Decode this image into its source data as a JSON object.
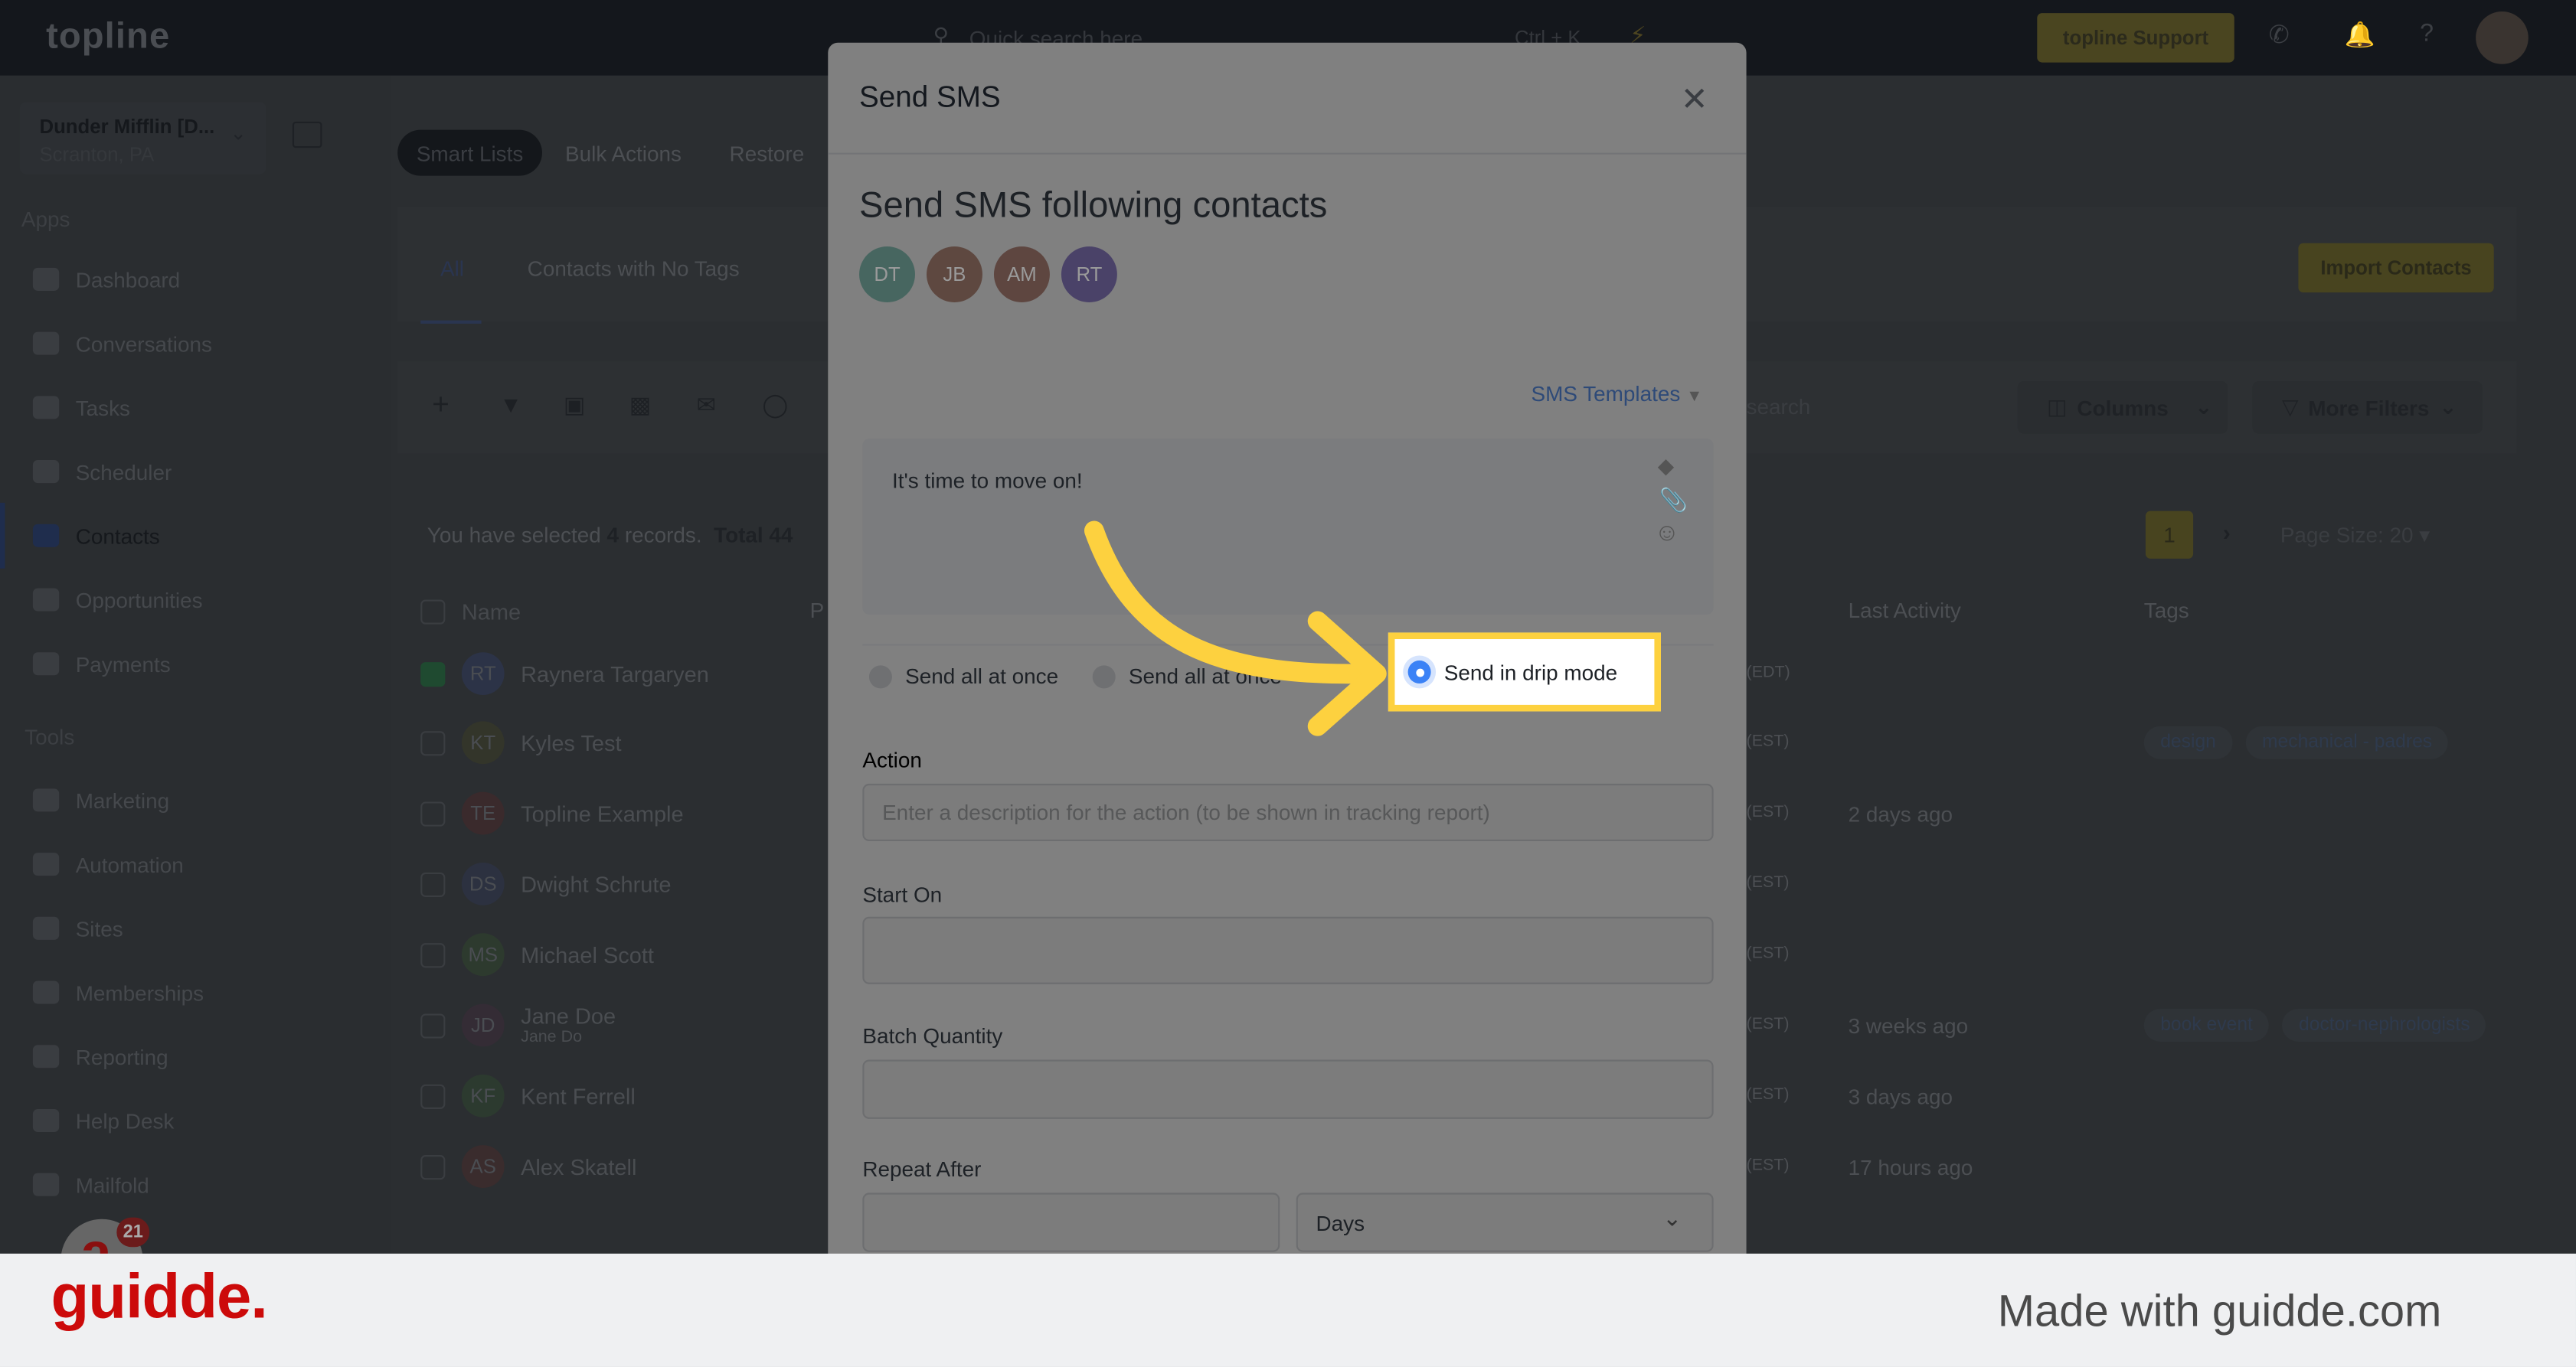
{
  "topbar": {
    "logo": "topline",
    "search_placeholder": "Quick search here",
    "search_shortcut": "Ctrl + K",
    "support_label": "topline Support",
    "icons": [
      "search-icon",
      "bolt-icon",
      "phone-icon",
      "bell-icon",
      "help-icon",
      "avatar"
    ]
  },
  "sidebar": {
    "account_name": "Dunder Mifflin [D...",
    "account_location": "Scranton, PA",
    "apps_label": "Apps",
    "apps": [
      {
        "label": "Dashboard"
      },
      {
        "label": "Conversations"
      },
      {
        "label": "Tasks"
      },
      {
        "label": "Scheduler"
      },
      {
        "label": "Contacts",
        "active": true
      },
      {
        "label": "Opportunities"
      },
      {
        "label": "Payments"
      }
    ],
    "tools_label": "Tools",
    "tools": [
      {
        "label": "Marketing"
      },
      {
        "label": "Automation"
      },
      {
        "label": "Sites"
      },
      {
        "label": "Memberships"
      },
      {
        "label": "Reporting"
      },
      {
        "label": "Help Desk"
      },
      {
        "label": "Mailfold"
      }
    ],
    "chat_badge": "21"
  },
  "contacts": {
    "top_tabs": [
      "Smart Lists",
      "Bulk Actions",
      "Restore"
    ],
    "list_tabs": [
      "All",
      "Contacts with No Tags"
    ],
    "import_label": "Import Contacts",
    "search_placeholder": "search",
    "columns_label": "Columns",
    "more_filters_label": "More Filters",
    "selected_prefix": "You have selected",
    "selected_count": "4",
    "selected_suffix": "records.",
    "total": "Total 44",
    "page": "1",
    "page_size": "Page Size: 20",
    "headers": {
      "name": "Name",
      "phone": "P",
      "last_activity": "Last Activity",
      "tags": "Tags"
    },
    "rows": [
      {
        "initials": "RT",
        "name": "Raynera Targaryen",
        "tz": "(EDT)",
        "activity": "",
        "tags": [],
        "checked": true,
        "color": "#2c3347"
      },
      {
        "initials": "KT",
        "name": "Kyles Test",
        "tz": "(EST)",
        "activity": "",
        "tags": [
          "design",
          "mechanical - padres"
        ],
        "color": "#33352a"
      },
      {
        "initials": "TE",
        "name": "Topline Example",
        "tz": "(EST)",
        "activity": "2 days ago",
        "tags": [],
        "color": "#3a2a2c"
      },
      {
        "initials": "DS",
        "name": "Dwight Schrute",
        "tz": "(EST)",
        "activity": "",
        "tags": [],
        "color": "#2c3140"
      },
      {
        "initials": "MS",
        "name": "Michael Scott",
        "tz": "(EST)",
        "activity": "",
        "tags": [],
        "color": "#2d3a2e"
      },
      {
        "initials": "JD",
        "name": "Jane Doe",
        "sub": "Jane Do",
        "tz": "(EST)",
        "activity": "3 weeks ago",
        "tags": [
          "book event",
          "doctor-nephrologists"
        ],
        "color": "#342c35"
      },
      {
        "initials": "KF",
        "name": "Kent Ferrell",
        "tz": "(EST)",
        "activity": "3 days ago",
        "tags": [],
        "color": "#2c3a2f"
      },
      {
        "initials": "AS",
        "name": "Alex Skatell",
        "tz": "(EST)",
        "activity": "17 hours ago",
        "tags": [],
        "color": "#3a2c2d"
      }
    ]
  },
  "modal": {
    "title": "Send SMS",
    "heading": "Send SMS following contacts",
    "recipients": [
      {
        "initials": "DT",
        "color": "#476660"
      },
      {
        "initials": "JB",
        "color": "#5e4840"
      },
      {
        "initials": "AM",
        "color": "#5e4640"
      },
      {
        "initials": "RT",
        "color": "#4a4268"
      }
    ],
    "templates_label": "SMS Templates",
    "message": "It's time to move on!",
    "send_options": [
      {
        "label": "Send all at once",
        "selected": false
      },
      {
        "label": "Send all at once",
        "selected": false
      },
      {
        "label": "Send in drip mode",
        "selected": true
      }
    ],
    "action_label": "Action",
    "action_placeholder": "Enter a description for the action (to be shown in tracking report)",
    "start_on_label": "Start On",
    "start_on_value": "",
    "batch_quantity_label": "Batch Quantity",
    "batch_quantity_value": "",
    "repeat_after_label": "Repeat After",
    "repeat_after_value": "",
    "repeat_unit": "Days",
    "accent_color": "#3b82f6",
    "highlight_color": "#fdd13f"
  },
  "footer": {
    "logo": "guidde.",
    "tagline": "Made with guidde.com"
  }
}
